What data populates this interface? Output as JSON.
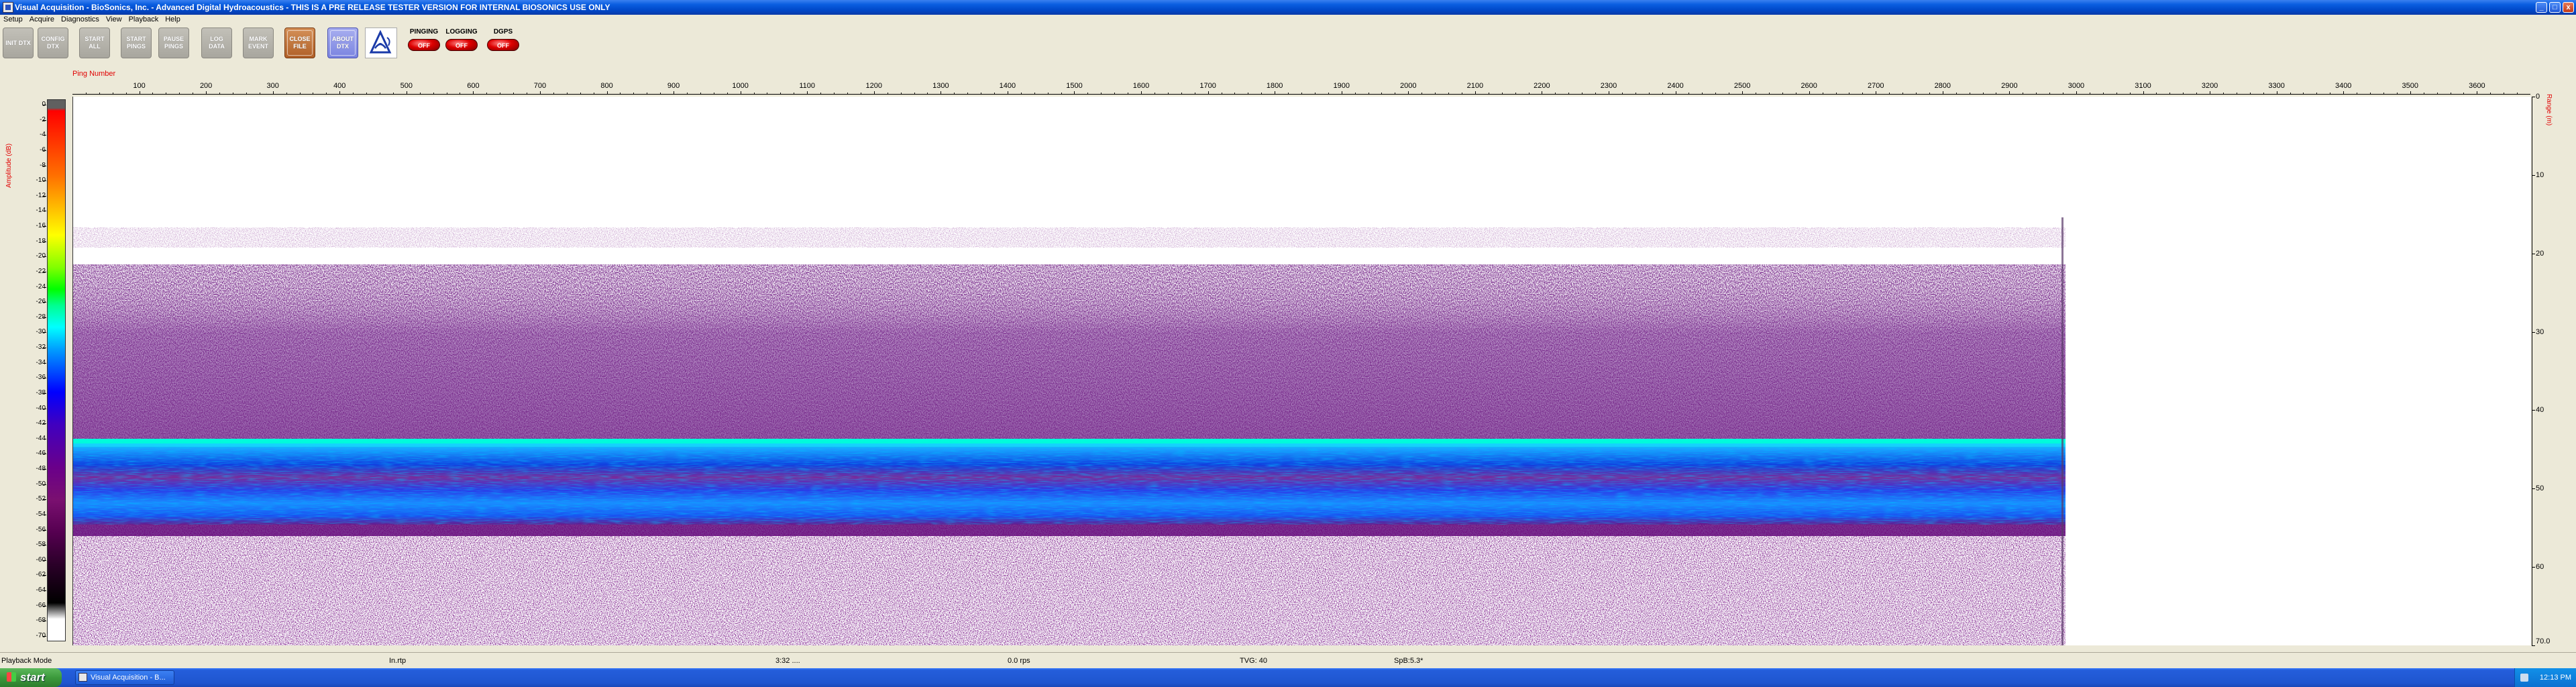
{
  "window": {
    "title": "Visual Acquisition  -  BioSonics, Inc.  -  Advanced Digital Hydroacoustics  -  THIS IS A PRE RELEASE TESTER VERSION FOR INTERNAL BIOSONICS USE ONLY",
    "minimize_label": "_",
    "close_label": "x"
  },
  "menu": [
    "Setup",
    "Acquire",
    "Diagnostics",
    "View",
    "Playback",
    "Help"
  ],
  "toolbar": {
    "buttons": [
      {
        "label": "INIT DTX"
      },
      {
        "label": "CONFIG DTX"
      },
      {
        "label": "START ALL"
      },
      {
        "label": "START PINGS"
      },
      {
        "label": "PAUSE PINGS"
      },
      {
        "label": "LOG DATA"
      },
      {
        "label": "MARK EVENT"
      },
      {
        "label": "CLOSE FILE"
      },
      {
        "label": "ABOUT DTX"
      }
    ],
    "indicators": [
      {
        "label": "PINGING",
        "state": "OFF"
      },
      {
        "label": "LOGGING",
        "state": "OFF"
      },
      {
        "label": "DGPS",
        "state": "OFF"
      }
    ]
  },
  "echogram": {
    "x_axis_label": "Ping Number",
    "x_ticks": [
      100,
      200,
      300,
      400,
      500,
      600,
      700,
      800,
      900,
      1000,
      1100,
      1200,
      1300,
      1400,
      1500,
      1600,
      1700,
      1800,
      1900,
      2000,
      2100,
      2200,
      2300,
      2400,
      2500,
      2600,
      2700,
      2800,
      2900,
      3000,
      3100,
      3200,
      3300,
      3400,
      3500,
      3600
    ],
    "x_max": 3680,
    "data_end_ping": 2965,
    "left_axis_label": "Amplitude (dB)",
    "amplitude_ticks": [
      0,
      -2,
      -4,
      -6,
      -8,
      -10,
      -12,
      -14,
      -16,
      -18,
      -20,
      -22,
      -24,
      -26,
      -28,
      -30,
      -32,
      -34,
      -36,
      -38,
      -40,
      -42,
      -44,
      -46,
      -48,
      -50,
      -52,
      -54,
      -56,
      -58,
      -60,
      -62,
      -64,
      -66,
      -68,
      -70
    ],
    "right_axis_label": "Range (m)",
    "range_ticks": [
      "0",
      "10",
      "20",
      "30",
      "40",
      "50",
      "60",
      "70.0"
    ],
    "range_max": 70,
    "colors": {
      "background": "#ffffff",
      "strong_band": "#0066ff",
      "weak_echo": "#5a0a7a"
    }
  },
  "statusbar": {
    "mode": "Playback Mode",
    "file": "In.rtp",
    "ping_info": "3:32 ....",
    "rate": "0.0 rps",
    "tvg": "TVG: 40",
    "spb": "SpB:5.3*"
  },
  "taskbar": {
    "start_label": "start",
    "task_label": "Visual Acquisition - B...",
    "clock": "12:13 PM"
  }
}
